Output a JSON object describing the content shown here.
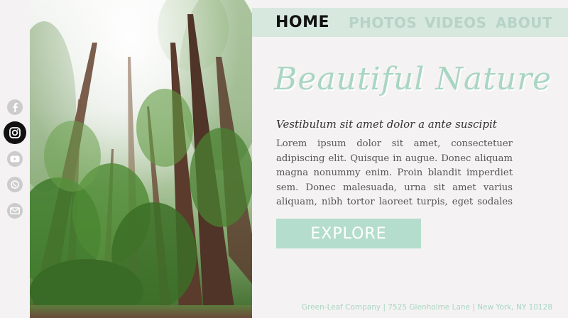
{
  "social": [
    {
      "name": "facebook-icon"
    },
    {
      "name": "instagram-icon"
    },
    {
      "name": "youtube-icon"
    },
    {
      "name": "whatsapp-icon"
    },
    {
      "name": "email-icon"
    }
  ],
  "nav": {
    "home": "HOME",
    "photos": "PHOTOS",
    "videos": "VIDEOS",
    "about": "ABOUT",
    "active": "HOME"
  },
  "hero": {
    "title": "Beautiful Nature",
    "subtitle": "Vestibulum sit amet dolor a ante suscipit",
    "body": "Lorem ipsum dolor sit amet, consectetuer adipiscing elit. Quisque in augue. Donec aliquam magna nonummy enim. Proin blandit imperdiet sem. Donec malesuada, urna sit amet varius aliquam, nibh tortor laoreet turpis, eget sodales",
    "button": "EXPLORE"
  },
  "footer": "Green-Leaf Company  |  7525 Glenholme Lane  |  New York, NY 10128",
  "colors": {
    "accent": "#a9d6c3",
    "nav_bg": "#d7e8df",
    "button_bg": "#b5ddcd",
    "page_bg": "#f4f2f3"
  }
}
